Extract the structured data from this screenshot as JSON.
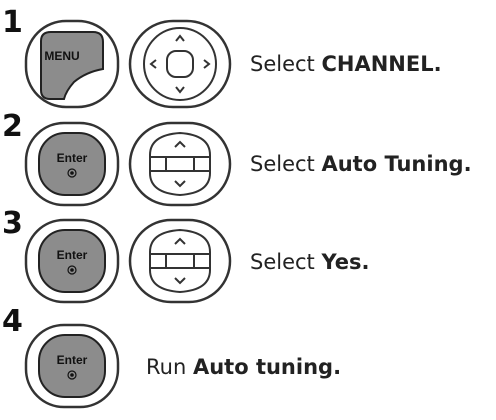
{
  "steps": [
    {
      "number": "1",
      "buttons": [
        "menu-button",
        "navigation-pad"
      ],
      "menu_label": "MENU",
      "text_prefix": "Select",
      "text_bold": "CHANNEL."
    },
    {
      "number": "2",
      "buttons": [
        "enter-button",
        "up-down-rocker"
      ],
      "enter_label": "Enter",
      "text_prefix": "Select",
      "text_bold": "Auto Tuning."
    },
    {
      "number": "3",
      "buttons": [
        "enter-button",
        "up-down-rocker"
      ],
      "enter_label": "Enter",
      "text_prefix": "Select",
      "text_bold": "Yes."
    },
    {
      "number": "4",
      "buttons": [
        "enter-button"
      ],
      "enter_label": "Enter",
      "text_prefix": "Run",
      "text_bold": "Auto tuning."
    }
  ],
  "colors": {
    "button_fill": "#8c8c8c",
    "button_ring": "#333333",
    "text": "#222222"
  }
}
